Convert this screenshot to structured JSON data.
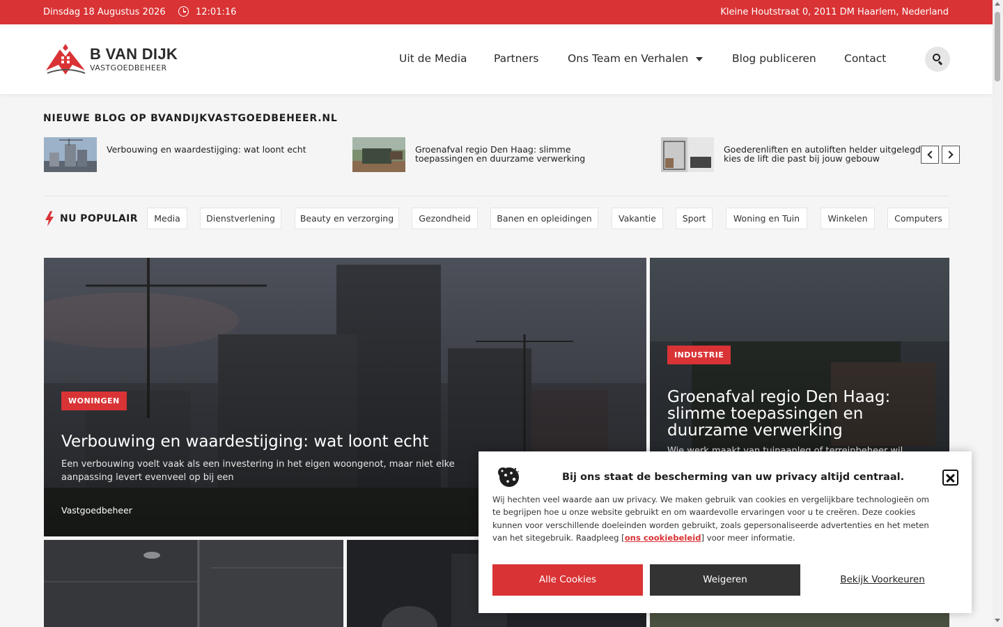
{
  "topbar": {
    "date": "Dinsdag 18 Augustus 2026",
    "time": "12:01:16",
    "address": "Kleine Houtstraat 0, 2011 DM Haarlem, Nederland"
  },
  "logo": {
    "title": "B VAN DIJK",
    "subtitle": "VASTGOEDBEHEER"
  },
  "nav": {
    "items": [
      "Uit de Media",
      "Partners",
      "Ons Team en Verhalen",
      "Blog publiceren",
      "Contact"
    ]
  },
  "new_blogs": {
    "title": "NIEUWE BLOG OP BVANDIJKVASTGOEDBEHEER.NL",
    "items": [
      {
        "title": "Verbouwing en waardestijging: wat loont echt"
      },
      {
        "title": "Groenafval regio Den Haag: slimme toepassingen en duurzame verwerking"
      },
      {
        "title": "Goederenliften en autoliften helder uitgelegd: kies de lift die past bij jouw gebouw"
      }
    ]
  },
  "popular": {
    "label": "NU POPULAIR",
    "tags": [
      "Media",
      "Dienstverlening",
      "Beauty en verzorging",
      "Gezondheid",
      "Banen en opleidingen",
      "Vakantie",
      "Sport",
      "Woning en Tuin",
      "Winkelen",
      "Computers"
    ]
  },
  "featured": [
    {
      "category": "WONINGEN",
      "title": "Verbouwing en waardestijging: wat loont echt",
      "excerpt": "Een verbouwing voelt vaak als een investering in het eigen woongenot, maar niet elke aanpassing levert evenveel op bij een",
      "author": "Vastgoedbeheer"
    },
    {
      "category": "INDUSTRIE",
      "title": "Groenafval regio Den Haag: slimme toepassingen en duurzame verwerking",
      "excerpt": "Wie werk maakt van tuinaanleg of terreinbeheer wil"
    }
  ],
  "cookie": {
    "title": "Bij ons staat de bescherming van uw privacy altijd centraal.",
    "text_before": "Wij hechten veel waarde aan uw privacy. We maken gebruik van cookies en vergelijkbare technologieën om te begrijpen hoe u onze website gebruikt en om waardevolle ervaringen voor u te creëren. Deze cookies kunnen voor verschillende doeleinden worden gebruikt, zoals gepersonaliseerde advertenties en het meten van het sitegebruik. Raadpleeg [",
    "link": "ons cookiebeleid",
    "text_after": "] voor meer informatie.",
    "accept": "Alle Cookies",
    "deny": "Weigeren",
    "prefs": "Bekijk Voorkeuren"
  },
  "colors": {
    "accent": "#d93335",
    "dark": "#333333"
  }
}
